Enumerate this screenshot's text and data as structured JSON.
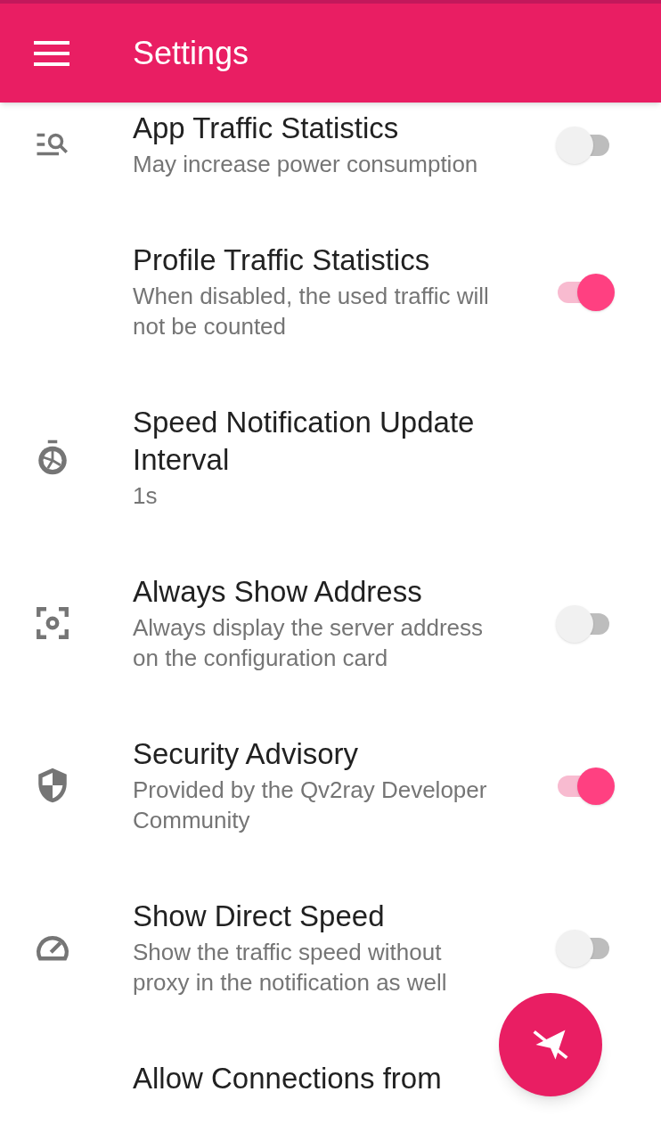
{
  "app_bar": {
    "title": "Settings"
  },
  "items": [
    {
      "title": "App Traffic Statistics",
      "summary": "May increase power consumption",
      "kind": "switch",
      "on": false
    },
    {
      "title": "Profile Traffic Statistics",
      "summary": "When disabled, the used traffic will not be counted",
      "kind": "switch",
      "on": true
    },
    {
      "title": "Speed Notification Update Interval",
      "summary": "1s",
      "kind": "value"
    },
    {
      "title": "Always Show Address",
      "summary": "Always display the server address on the configuration card",
      "kind": "switch",
      "on": false
    },
    {
      "title": "Security Advisory",
      "summary": "Provided by the Qv2ray Developer Community",
      "kind": "switch",
      "on": true
    },
    {
      "title": "Show Direct Speed",
      "summary": "Show the traffic speed without proxy in the notification as well",
      "kind": "switch",
      "on": false
    },
    {
      "title": "Allow Connections from",
      "kind": "value"
    }
  ]
}
